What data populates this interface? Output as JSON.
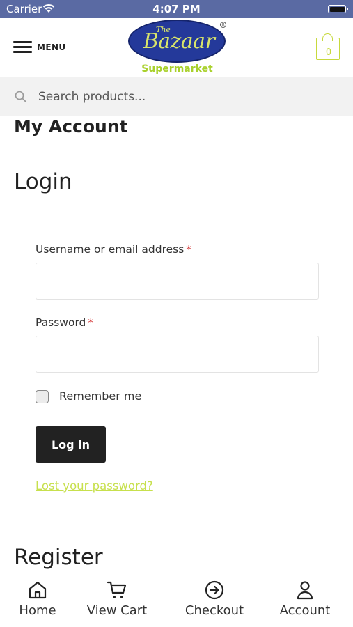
{
  "status_bar": {
    "carrier": "Carrier",
    "time": "4:07 PM"
  },
  "header": {
    "menu_label": "MENU",
    "logo": {
      "the": "The",
      "name": "Bazaar",
      "tagline": "Supermarket"
    },
    "cart_count": "0"
  },
  "search": {
    "placeholder": "Search products..."
  },
  "page": {
    "title": "My Account",
    "login_heading": "Login",
    "register_heading": "Register"
  },
  "login_form": {
    "username_label": "Username or email address",
    "password_label": "Password",
    "required_marker": "*",
    "remember_label": "Remember me",
    "submit_label": "Log in",
    "lost_password": "Lost your password?"
  },
  "tab_bar": {
    "tabs": [
      {
        "label": "Home",
        "icon": "home-icon"
      },
      {
        "label": "View Cart",
        "icon": "cart-icon"
      },
      {
        "label": "Checkout",
        "icon": "arrow-circle-right-icon"
      },
      {
        "label": "Account",
        "icon": "user-icon"
      }
    ]
  },
  "colors": {
    "status_bar": "#5a6aa3",
    "logo_blue": "#24399a",
    "logo_green": "#a9d12c",
    "accent_link": "#c7e04d",
    "button_dark": "#222222",
    "required": "#d32f2f"
  }
}
